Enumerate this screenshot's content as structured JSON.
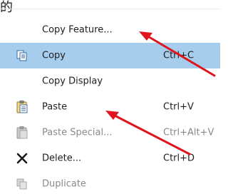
{
  "heading_fragment": "的",
  "menu": {
    "items": [
      {
        "label": "Copy Feature...",
        "shortcut": "",
        "icon": "none",
        "state": "normal"
      },
      {
        "label": "Copy",
        "shortcut": "Ctrl+C",
        "icon": "copy-icon",
        "state": "highlighted"
      },
      {
        "label": "Copy Display",
        "shortcut": "",
        "icon": "none",
        "state": "normal"
      },
      {
        "label": "Paste",
        "shortcut": "Ctrl+V",
        "icon": "paste-icon",
        "state": "normal"
      },
      {
        "label": "Paste Special...",
        "shortcut": "Ctrl+Alt+V",
        "icon": "paste-special-icon",
        "state": "disabled"
      },
      {
        "label": "Delete...",
        "shortcut": "Ctrl+D",
        "icon": "delete-x-icon",
        "state": "normal"
      },
      {
        "label": "Duplicate",
        "shortcut": "",
        "icon": "duplicate-icon",
        "state": "disabled"
      }
    ]
  },
  "colors": {
    "highlight": "#a6cdec",
    "annotation_arrow": "#e0141e"
  }
}
